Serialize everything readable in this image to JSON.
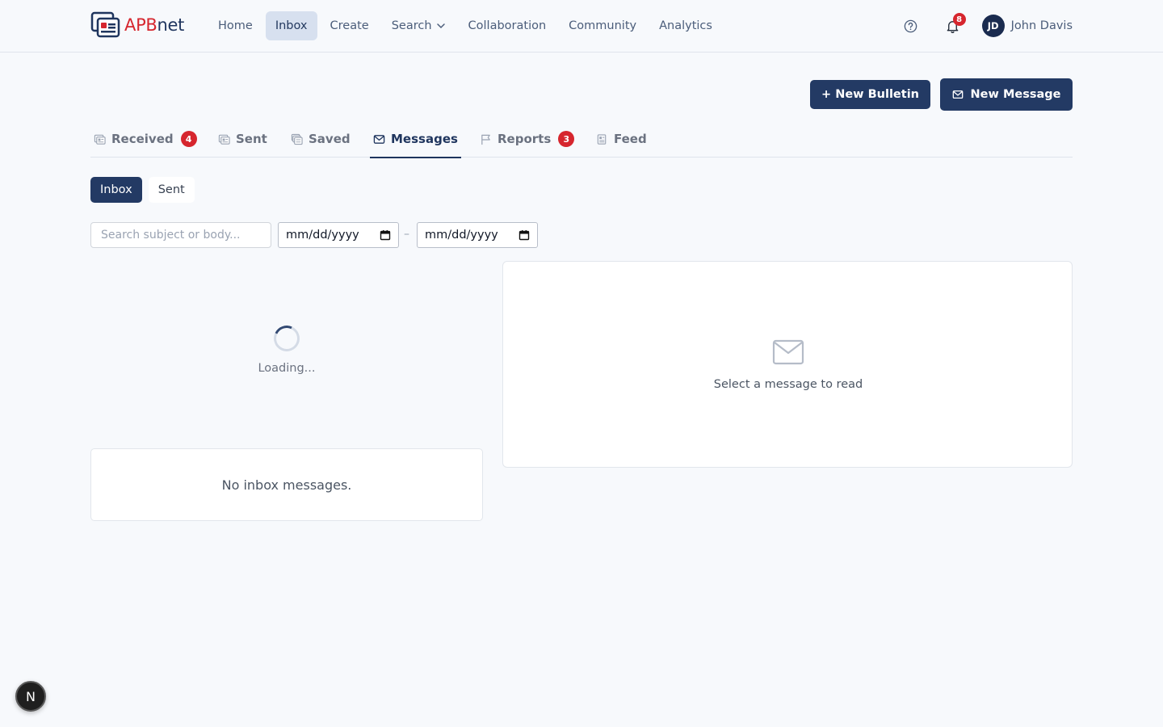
{
  "brand": {
    "part1": "APB",
    "part2": "net"
  },
  "nav": [
    {
      "label": "Home",
      "active": false
    },
    {
      "label": "Inbox",
      "active": true
    },
    {
      "label": "Create",
      "active": false
    },
    {
      "label": "Search",
      "active": false,
      "dropdown": true
    },
    {
      "label": "Collaboration",
      "active": false
    },
    {
      "label": "Community",
      "active": false
    },
    {
      "label": "Analytics",
      "active": false
    }
  ],
  "header": {
    "notifications_count": "8",
    "user": {
      "initials": "JD",
      "name": "John Davis"
    }
  },
  "actions": {
    "new_bulletin": "+ New Bulletin",
    "new_message": "New Message"
  },
  "tabs": [
    {
      "label": "Received",
      "badge": "4",
      "icon": "bulletin-icon"
    },
    {
      "label": "Sent",
      "icon": "bulletin-icon"
    },
    {
      "label": "Saved",
      "icon": "bulletin-stack-icon"
    },
    {
      "label": "Messages",
      "icon": "envelope-icon",
      "active": true
    },
    {
      "label": "Reports",
      "badge": "3",
      "icon": "flag-icon"
    },
    {
      "label": "Feed",
      "icon": "feed-icon"
    }
  ],
  "subtabs": {
    "inbox": "Inbox",
    "sent": "Sent"
  },
  "filters": {
    "search_placeholder": "Search subject or body...",
    "date_from": "mm/dd/yyyy",
    "date_separator": "–",
    "date_to": "mm/dd/yyyy"
  },
  "list": {
    "loading": "Loading...",
    "empty": "No inbox messages."
  },
  "reader": {
    "placeholder": "Select a message to read"
  },
  "fab": {
    "label": "N"
  },
  "colors": {
    "primary": "#233a64",
    "badge": "#d6262e",
    "active_nav_bg": "#d7e0ef",
    "page_bg": "#f7f9fc"
  }
}
